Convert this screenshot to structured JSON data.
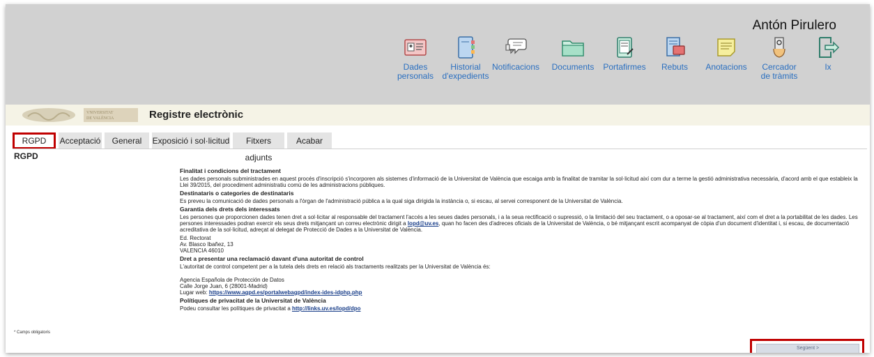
{
  "header": {
    "user_name": "Antón Pirulero"
  },
  "nav": [
    {
      "label": "Dades\npersonals",
      "icon": "id-card-icon"
    },
    {
      "label": "Historial\nd'expedients",
      "icon": "binder-icon"
    },
    {
      "label": "Notificacions",
      "icon": "chat-bubbles-icon"
    },
    {
      "label": "Documents",
      "icon": "folder-icon"
    },
    {
      "label": "Portafirmes",
      "icon": "signing-tablet-icon"
    },
    {
      "label": "Rebuts",
      "icon": "receipt-icon"
    },
    {
      "label": "Anotacions",
      "icon": "notepad-icon"
    },
    {
      "label": "Cercador\nde tràmits",
      "icon": "search-hand-icon"
    },
    {
      "label": "Ix",
      "icon": "logout-icon"
    }
  ],
  "brand": {
    "logo_text": "VNIVERSITAT\nDE VALÈNCIA"
  },
  "page": {
    "title": "Registre electrònic"
  },
  "tabs": [
    {
      "label": "RGPD",
      "active": true
    },
    {
      "label": "Acceptació"
    },
    {
      "label": "General"
    },
    {
      "label": "Exposició i sol·licitud"
    },
    {
      "label": "Fitxers adjunts"
    },
    {
      "label": "Acabar"
    }
  ],
  "section": {
    "title": "RGPD"
  },
  "content": {
    "h1": "Finalitat i condicions del tractament",
    "p1": "Les dades personals subministrades en aquest procés d'inscripció s'incorporen als sistemes d'informació de la Universitat de València que escaiga amb la finalitat de tramitar la sol·licitud així com dur a terme la gestió administrativa necessària, d'acord amb el que estableix la Llei 39/2015, del procediment administratiu comú de les administracions públiques.",
    "h2": "Destinataris o categories de destinataris",
    "p2": "Es preveu la comunicació de dades personals a l'òrgan de l'administració pública a la qual siga dirigida la instància o, si escau, al servei corresponent de la Universitat de València.",
    "h3": "Garantia dels drets dels interessats",
    "p3a": "Les persones que proporcionen dades tenen dret a sol·licitar al responsable del tractament l'accés a les seues dades personals, i a la seua rectificació o supressió, o la limitació del seu tractament, o a oposar-se al tractament, així com el dret a la portabilitat de les dades. Les persones interessades podran exercir els seus drets mitjançant un correu electrònic dirigit a ",
    "email": "lopd@uv.es",
    "p3b": ", quan ho facen des d'adreces oficials de la Universitat de València, o bé mitjançant escrit acompanyat de còpia d'un document d'identitat i, si escau, de documentació acreditativa de la sol·licitud, adreçat al delegat de Protecció de Dades a la Universitat de València.",
    "addr1": "Ed. Rectorat",
    "addr2": "Av. Blasco Ibañez, 13",
    "addr3": "VALENCIA 46010",
    "h4": "Dret a presentar una reclamació davant d'una autoritat de control",
    "p4": "L'autoritat de control competent per a la tutela dels drets en relació als tractaments realitzats per la Universitat de València és:",
    "agency1": "Agencia Española de Protección de Datos",
    "agency2": "Calle Jorge Juan, 6 (28001-Madrid)",
    "agency3_label": "Lugar web: ",
    "agency_link": "https://www.agpd.es/portalwebagpd/index-ides-idphp.php",
    "h5": "Polítiques de privacitat de la Universitat de València",
    "p5_label": "Podeu consultar les polítiques de privacitat a ",
    "policy_link": "http://links.uv.es/lopd/dpo"
  },
  "footer": {
    "mandatory": "* Camps obligatoris",
    "next_label": "Següent >"
  },
  "colors": {
    "accent_red": "#c00000",
    "link_blue": "#2a6fc0",
    "topbar": "#d1d1d1"
  }
}
